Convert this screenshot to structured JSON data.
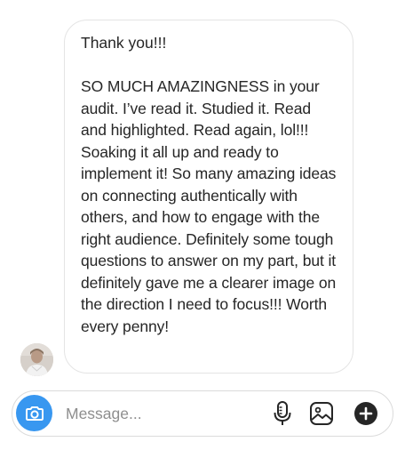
{
  "message": {
    "line1": "Thank you!!!",
    "body": "SO MUCH AMAZINGNESS in your audit.  I’ve read it.  Studied it.  Read and highlighted.  Read again, lol!!!  Soaking it all up and ready to implement it!  So many amazing ideas on connecting authentically with others, and how to engage with the right audience.  Definitely some tough questions to answer on my part, but it definitely gave me a clearer image on the direction I need to focus!!!  Worth every penny!"
  },
  "composer": {
    "placeholder": "Message..."
  },
  "icons": {
    "camera": "camera-icon",
    "mic": "microphone-icon",
    "gallery": "gallery-icon",
    "plus": "plus-circle-icon"
  },
  "colors": {
    "accent": "#3897f0",
    "text": "#262626",
    "placeholder": "#8e8e8e",
    "border": "#dbdbdb"
  }
}
